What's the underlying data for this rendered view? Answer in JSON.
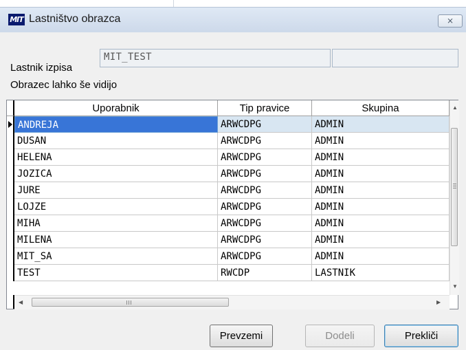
{
  "window": {
    "title": "Lastništvo obrazca",
    "close_label": "⨯"
  },
  "form": {
    "owner_label": "Lastnik izpisa",
    "owner_value": "MIT_TEST",
    "owner_extra": "",
    "visibility_label": "Obrazec lahko še vidijo"
  },
  "grid": {
    "columns": [
      "Uporabnik",
      "Tip pravice",
      "Skupina"
    ],
    "rows": [
      [
        "ANDREJA",
        "ARWCDPG",
        "ADMIN"
      ],
      [
        "DUSAN",
        "ARWCDPG",
        "ADMIN"
      ],
      [
        "HELENA",
        "ARWCDPG",
        "ADMIN"
      ],
      [
        "JOZICA",
        "ARWCDPG",
        "ADMIN"
      ],
      [
        "JURE",
        "ARWCDPG",
        "ADMIN"
      ],
      [
        "LOJZE",
        "ARWCDPG",
        "ADMIN"
      ],
      [
        "MIHA",
        "ARWCDPG",
        "ADMIN"
      ],
      [
        "MILENA",
        "ARWCDPG",
        "ADMIN"
      ],
      [
        "MIT_SA",
        "ARWCDPG",
        "ADMIN"
      ],
      [
        "TEST",
        "RWCDP",
        "LASTNIK"
      ]
    ],
    "selected_row": 0
  },
  "buttons": {
    "take": "Prevzemi",
    "assign": "Dodeli",
    "cancel": "Prekliči"
  },
  "icons": {
    "app": "MIT",
    "scroll_up": "▲",
    "scroll_down": "▼",
    "scroll_left": "◀",
    "scroll_right": "▶"
  },
  "colors": {
    "selection": "#3875d7",
    "selected_row_bg": "#d8e6f2",
    "titlebar": "#dfe9f5"
  }
}
